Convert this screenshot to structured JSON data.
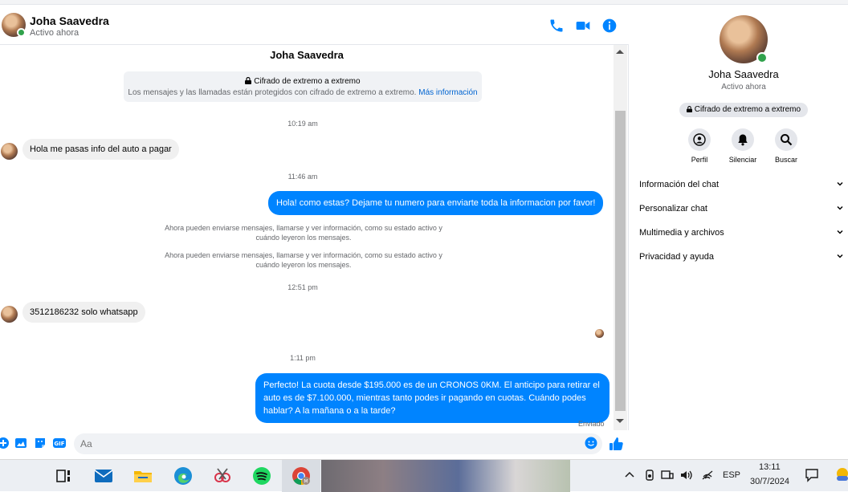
{
  "contact": {
    "name": "Joha Saavedra",
    "status": "Activo ahora"
  },
  "chat": {
    "title": "Joha Saavedra",
    "e2e_title": "Cifrado de extremo a extremo",
    "e2e_body": "Los mensajes y las llamadas están protegidos con cifrado de extremo a extremo.",
    "e2e_link": "Más información",
    "ts1": "10:19 am",
    "msg1": "Hola me pasas info del auto a pagar",
    "ts2": "11:46 am",
    "msg2": "Hola! como estas? Dejame tu numero para enviarte toda la informacion por favor!",
    "sys1": "Ahora pueden enviarse mensajes, llamarse y ver información, como su estado activo y cuándo leyeron los mensajes.",
    "sys2": "Ahora pueden enviarse mensajes, llamarse y ver información, como su estado activo y cuándo leyeron los mensajes.",
    "ts3": "12:51 pm",
    "msg3": "3512186232 solo whatsapp",
    "ts4": "1:11 pm",
    "msg4": "Perfecto! La cuota desde $195.000 es de un CRONOS 0KM. El anticipo para retirar el auto es de $7.100.000, mientras tanto podes ir pagando en cuotas. Cuándo podes hablar? A la mañana o a la tarde?",
    "sent": "Enviado"
  },
  "composer": {
    "placeholder": "Aa"
  },
  "side": {
    "e2e": "Cifrado de extremo a extremo",
    "actions": {
      "profile": "Perfil",
      "mute": "Silenciar",
      "search": "Buscar"
    },
    "menu": [
      "Información del chat",
      "Personalizar chat",
      "Multimedia y archivos",
      "Privacidad y ayuda"
    ]
  },
  "taskbar": {
    "lang": "ESP",
    "time": "13:11",
    "date": "30/7/2024"
  },
  "colors": {
    "accent": "#0084ff",
    "online": "#31a24c"
  },
  "icons": [
    "phone-icon",
    "video-icon",
    "info-icon",
    "plus-icon",
    "image-icon",
    "sticker-icon",
    "gif-icon",
    "emoji-icon",
    "like-icon",
    "lock-icon",
    "bell-icon",
    "search-icon",
    "chevron-down-icon"
  ]
}
